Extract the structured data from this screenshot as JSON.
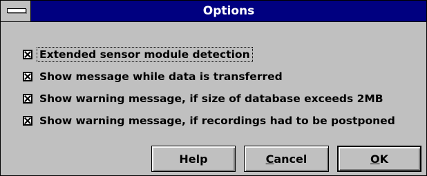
{
  "window": {
    "title": "Options"
  },
  "options": [
    {
      "label": "Extended sensor module detection",
      "checked": true,
      "focused": true
    },
    {
      "label": "Show message while data is transferred",
      "checked": true,
      "focused": false
    },
    {
      "label": "Show warning message, if size of database exceeds 2MB",
      "checked": true,
      "focused": false
    },
    {
      "label": "Show warning message, if recordings had to be postponed",
      "checked": true,
      "focused": false
    }
  ],
  "buttons": {
    "help": "Help",
    "cancel_mnemonic": "C",
    "cancel_rest": "ancel",
    "ok_mnemonic": "O",
    "ok_rest": "K"
  },
  "icons": {
    "system_menu": "system-menu-icon",
    "checkbox_checked": "checkbox-checked-icon"
  },
  "colors": {
    "titlebar": "#000080",
    "face": "#c0c0c0"
  }
}
